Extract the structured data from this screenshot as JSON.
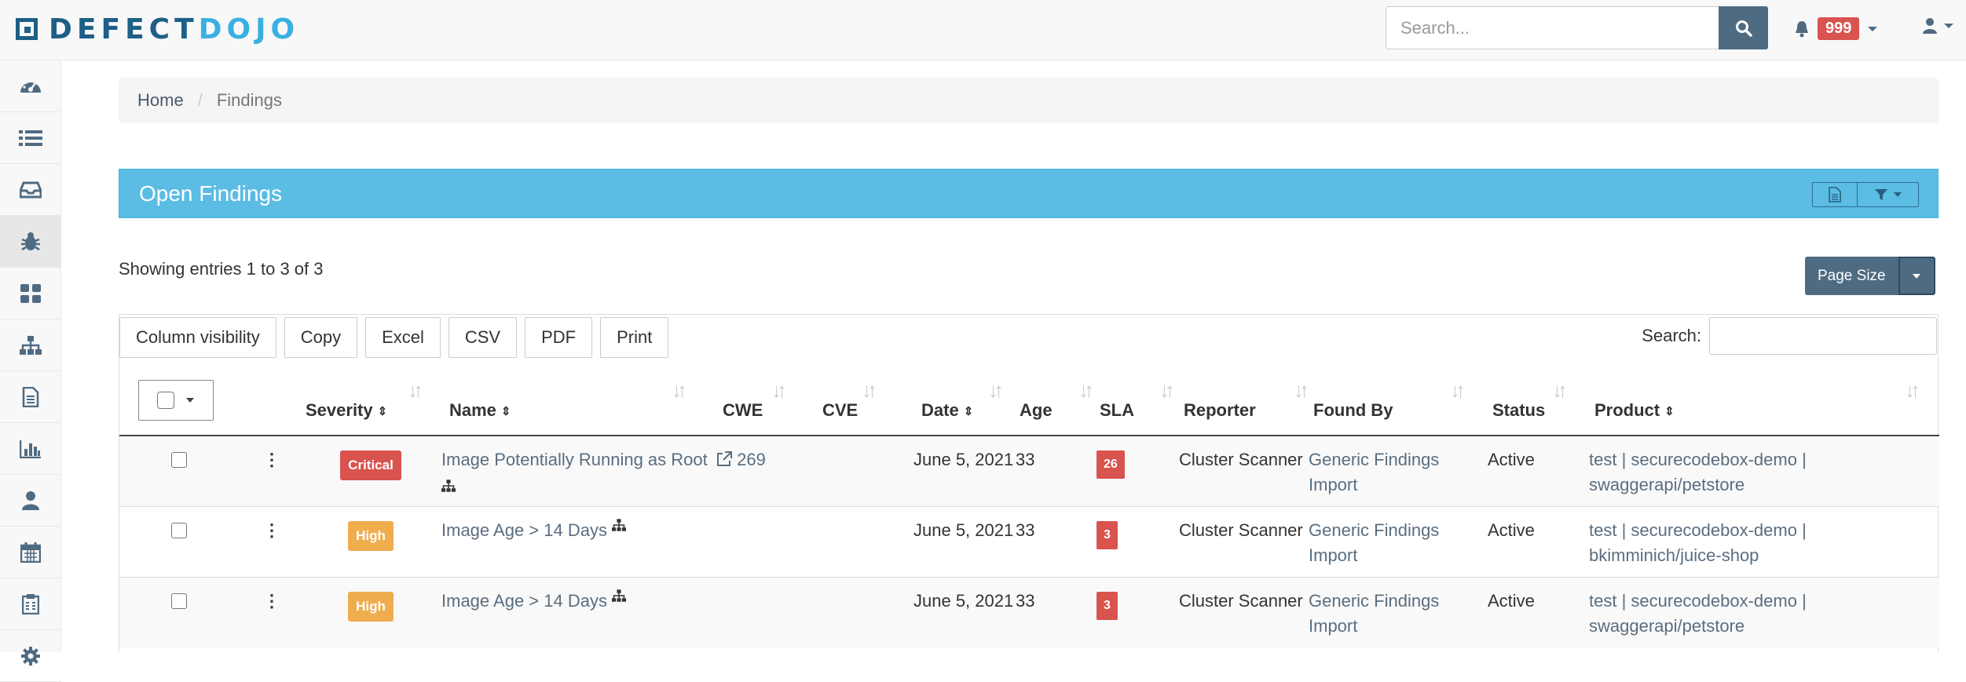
{
  "app": {
    "logo_part1": "DEFECT",
    "logo_part2": "DOJO"
  },
  "header": {
    "search_placeholder": "Search...",
    "alert_count": "999"
  },
  "sidebar": {
    "items": [
      {
        "icon": "dashboard-icon"
      },
      {
        "icon": "list-icon"
      },
      {
        "icon": "inbox-icon"
      },
      {
        "icon": "bug-icon",
        "active": true
      },
      {
        "icon": "grid-icon"
      },
      {
        "icon": "sitemap-icon"
      },
      {
        "icon": "file-icon"
      },
      {
        "icon": "bar-chart-icon"
      },
      {
        "icon": "user-icon"
      },
      {
        "icon": "calendar-icon"
      },
      {
        "icon": "clipboard-icon"
      },
      {
        "icon": "gear-icon"
      }
    ]
  },
  "breadcrumb": {
    "home": "Home",
    "current": "Findings"
  },
  "panel": {
    "title": "Open Findings"
  },
  "listing": {
    "showing": "Showing entries 1 to 3 of 3",
    "page_size_label": "Page Size",
    "search_label": "Search:"
  },
  "export_buttons": [
    "Column visibility",
    "Copy",
    "Excel",
    "CSV",
    "PDF",
    "Print"
  ],
  "columns": {
    "severity": "Severity",
    "name": "Name",
    "cwe": "CWE",
    "cve": "CVE",
    "date": "Date",
    "age": "Age",
    "sla": "SLA",
    "reporter": "Reporter",
    "found_by": "Found By",
    "status": "Status",
    "product": "Product"
  },
  "findings": [
    {
      "severity": "Critical",
      "severity_color": "#d9534f",
      "name": "Image Potentially Running as Root",
      "cwe": "269",
      "cve": "",
      "date": "June 5, 2021",
      "age": "33",
      "sla": "26",
      "reporter": "Cluster Scanner",
      "found_by": "Generic Findings Import",
      "status": "Active",
      "product": "test | securecodebox-demo | swaggerapi/petstore"
    },
    {
      "severity": "High",
      "severity_color": "#f0ad4e",
      "name": "Image Age > 14 Days",
      "cwe": "",
      "cve": "",
      "date": "June 5, 2021",
      "age": "33",
      "sla": "3",
      "reporter": "Cluster Scanner",
      "found_by": "Generic Findings Import",
      "status": "Active",
      "product": "test | securecodebox-demo | bkimminich/juice-shop"
    },
    {
      "severity": "High",
      "severity_color": "#f0ad4e",
      "name": "Image Age > 14 Days",
      "cwe": "",
      "cve": "",
      "date": "June 5, 2021",
      "age": "33",
      "sla": "3",
      "reporter": "Cluster Scanner",
      "found_by": "Generic Findings Import",
      "status": "Active",
      "product": "test | securecodebox-demo | swaggerapi/petstore"
    }
  ]
}
